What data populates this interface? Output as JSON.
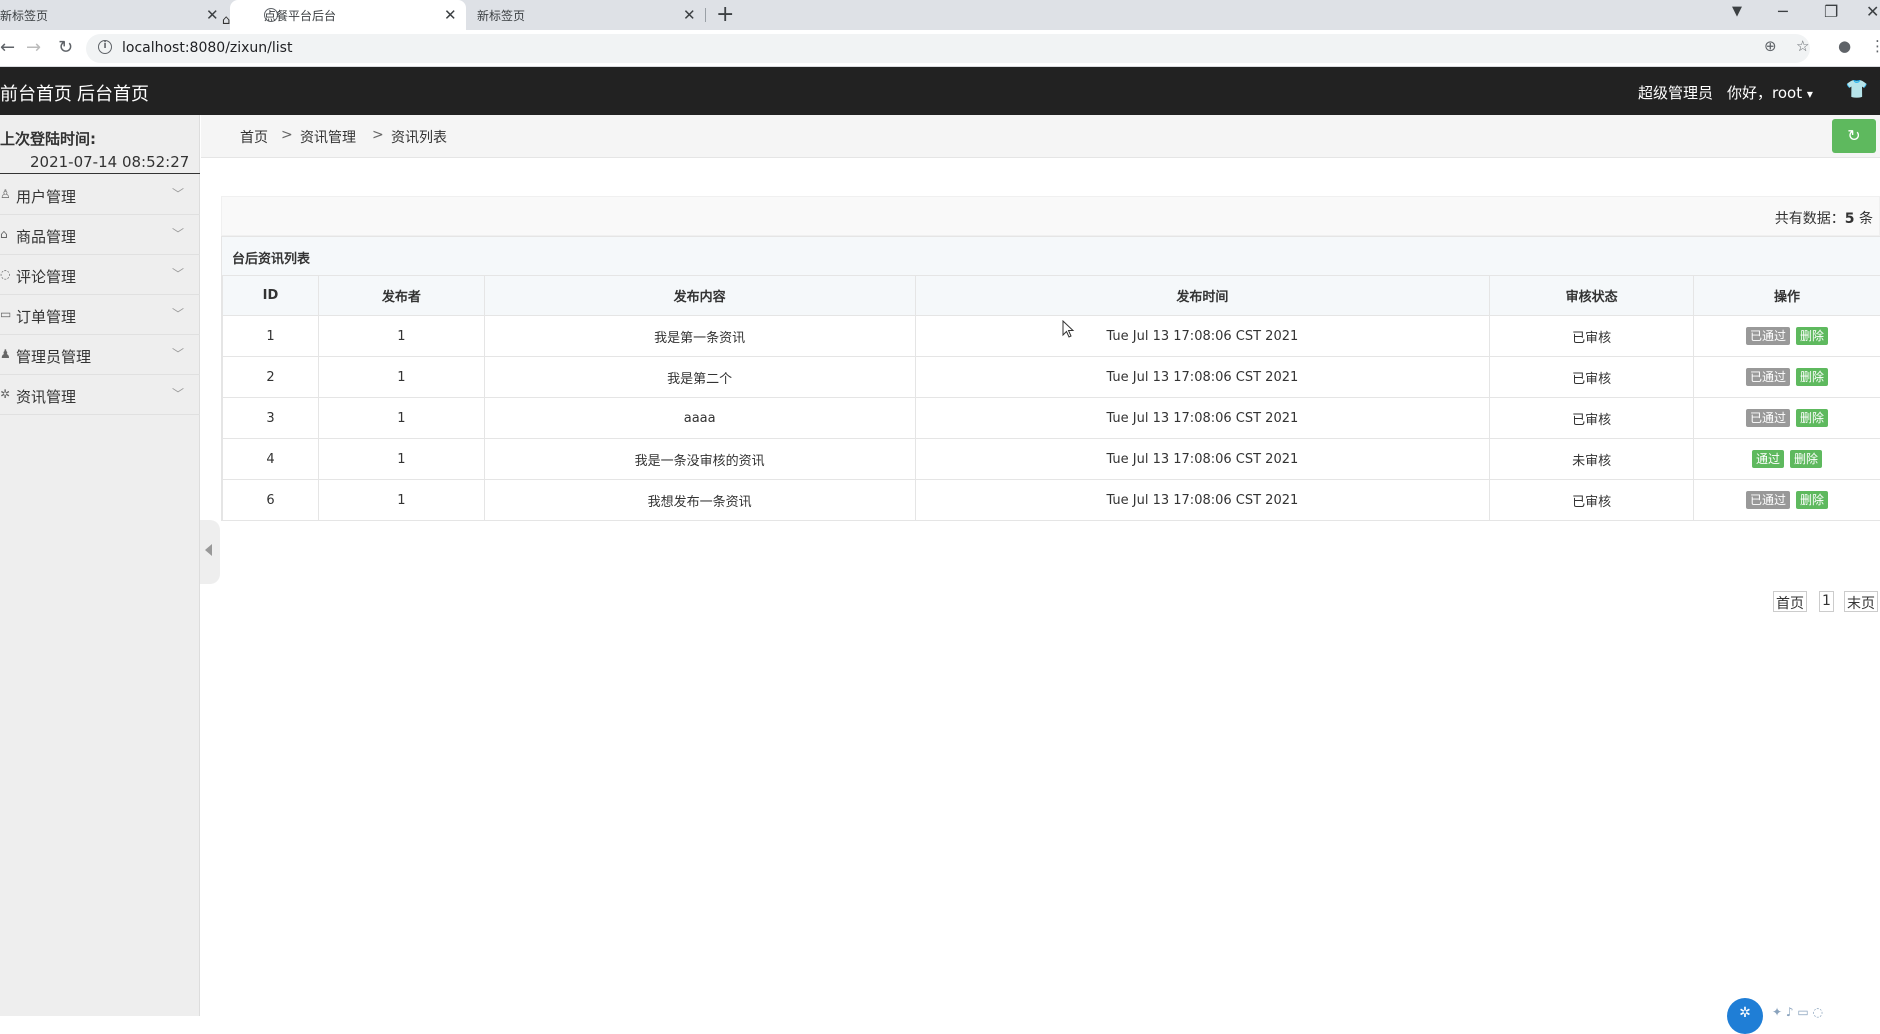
{
  "browser": {
    "tabs": [
      {
        "title": "新标签页"
      },
      {
        "title": "点餐平台后台"
      },
      {
        "title": "新标签页"
      }
    ],
    "url": "localhost:8080/zixun/list"
  },
  "header": {
    "front_home": "前台首页",
    "back_home": "后台首页",
    "role": "超级管理员",
    "greeting": "你好，root"
  },
  "sidebar": {
    "last_login_label": "上次登陆时间:",
    "last_login_time": "2021-07-14 08:52:27",
    "items": [
      {
        "label": "用户管理",
        "icon": "user-icon"
      },
      {
        "label": "商品管理",
        "icon": "bag-icon"
      },
      {
        "label": "评论管理",
        "icon": "comment-icon"
      },
      {
        "label": "订单管理",
        "icon": "ticket-icon"
      },
      {
        "label": "管理员管理",
        "icon": "admin-icon"
      },
      {
        "label": "资讯管理",
        "icon": "gear-icon"
      }
    ]
  },
  "breadcrumb": {
    "home": "首页",
    "level1": "资讯管理",
    "level2": "资讯列表",
    "sep": ">"
  },
  "summary": {
    "prefix": "共有数据：",
    "count": "5",
    "suffix": " 条"
  },
  "table": {
    "caption": "台后资讯列表",
    "columns": [
      "ID",
      "发布者",
      "发布内容",
      "发布时间",
      "审核状态",
      "操作"
    ],
    "rows": [
      {
        "id": "1",
        "publisher": "1",
        "content": "我是第一条资讯",
        "time": "Tue Jul 13 17:08:06 CST 2021",
        "status": "已审核",
        "action1": "已通过",
        "action2": "删除"
      },
      {
        "id": "2",
        "publisher": "1",
        "content": "我是第二个",
        "time": "Tue Jul 13 17:08:06 CST 2021",
        "status": "已审核",
        "action1": "已通过",
        "action2": "删除"
      },
      {
        "id": "3",
        "publisher": "1",
        "content": "aaaa",
        "time": "Tue Jul 13 17:08:06 CST 2021",
        "status": "已审核",
        "action1": "已通过",
        "action2": "删除"
      },
      {
        "id": "4",
        "publisher": "1",
        "content": "我是一条没审核的资讯",
        "time": "Tue Jul 13 17:08:06 CST 2021",
        "status": "未审核",
        "action1": "通过",
        "action2": "删除"
      },
      {
        "id": "6",
        "publisher": "1",
        "content": "我想发布一条资讯",
        "time": "Tue Jul 13 17:08:06 CST 2021",
        "status": "已审核",
        "action1": "已通过",
        "action2": "删除"
      }
    ]
  },
  "pagination": {
    "first": "首页",
    "current": "1",
    "last": "末页"
  },
  "colors": {
    "header_bg": "#222222",
    "accent_green": "#5eb95e",
    "badge_gray": "#999999"
  }
}
